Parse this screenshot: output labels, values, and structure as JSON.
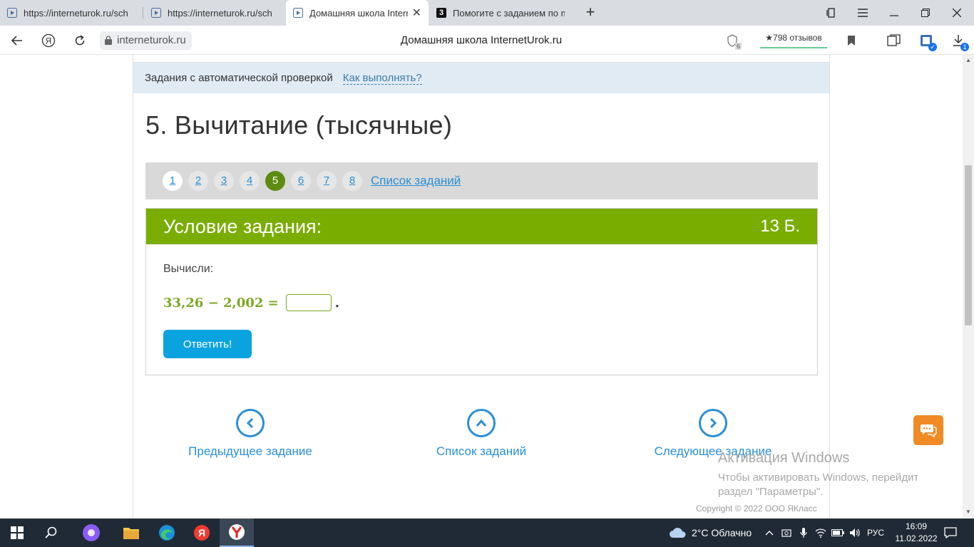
{
  "browser": {
    "tabs": [
      {
        "title": "https://interneturok.ru/sch"
      },
      {
        "title": "https://interneturok.ru/sch"
      },
      {
        "title": "Домашняя школа Intern"
      },
      {
        "title": "Помогите с заданием по m"
      }
    ],
    "tab4_favicon_letter": "3",
    "url": "interneturok.ru",
    "page_title": "Домашняя школа InternetUrok.ru",
    "reviews": "★798 отзывов",
    "tab_count_badge": "6",
    "downloads_badge": "1"
  },
  "page": {
    "notice_text": "Задания с автоматической проверкой",
    "notice_link": "Как выполнять?",
    "heading": "5. Вычитание (тысячные)",
    "pager": {
      "numbers": [
        "1",
        "2",
        "3",
        "4",
        "5",
        "6",
        "7",
        "8"
      ],
      "current": "5",
      "list_link": "Список заданий"
    },
    "task": {
      "title": "Условие задания:",
      "points": "13 Б.",
      "instruction": "Вычисли:",
      "expression": "33,26 − 2,002 =",
      "trailing": ".",
      "answer_button": "Ответить!"
    },
    "nav": {
      "prev": "Предыдущее задание",
      "list": "Список заданий",
      "next": "Следующее задание"
    },
    "watermark_title": "Активация Windows",
    "watermark_line1": "Чтобы активировать Windows, перейдите в",
    "watermark_line2": "раздел \"Параметры\".",
    "copyright": "Copyright © 2022 ООО ЯКласс"
  },
  "taskbar": {
    "weather": "2°C Облачно",
    "lang": "РУС",
    "time": "16:09",
    "date": "11.02.2022"
  },
  "colors": {
    "green_header": "#79ad00",
    "pager_current": "#5d8c10",
    "link_blue": "#2a8fd4",
    "answer_button": "#0aa3e0",
    "notice_bg": "#e1ebf4"
  }
}
